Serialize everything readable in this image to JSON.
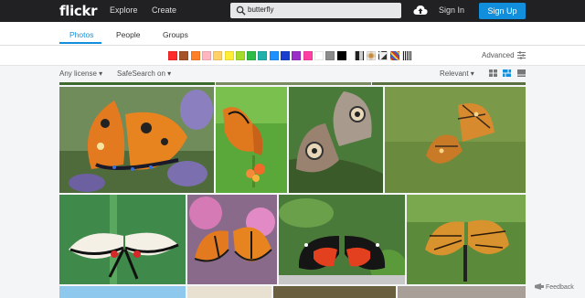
{
  "header": {
    "logo": "flickr",
    "nav": [
      "Explore",
      "Create"
    ],
    "search_value": "butterfly",
    "sign_in": "Sign In",
    "sign_up": "Sign Up"
  },
  "tabs": [
    {
      "label": "Photos",
      "active": true
    },
    {
      "label": "People",
      "active": false
    },
    {
      "label": "Groups",
      "active": false
    }
  ],
  "colors": [
    "#ff2a2a",
    "#a5542a",
    "#ff7f27",
    "#ffb6c1",
    "#ffd166",
    "#ffee33",
    "#a5dc2a",
    "#2ebd44",
    "#20b2aa",
    "#1e90ff",
    "#1a3fcf",
    "#9b30c8",
    "#ff3fa4",
    "#ffffff",
    "#8c8c8c",
    "#000000"
  ],
  "styles": [
    "black-and-white",
    "shallow-depth-of-field",
    "minimalist",
    "pattern"
  ],
  "advanced": "Advanced",
  "filters": {
    "license": "Any license",
    "safesearch": "SafeSearch on",
    "sort": "Relevant"
  },
  "footer": {
    "feedback": "Feedback"
  }
}
